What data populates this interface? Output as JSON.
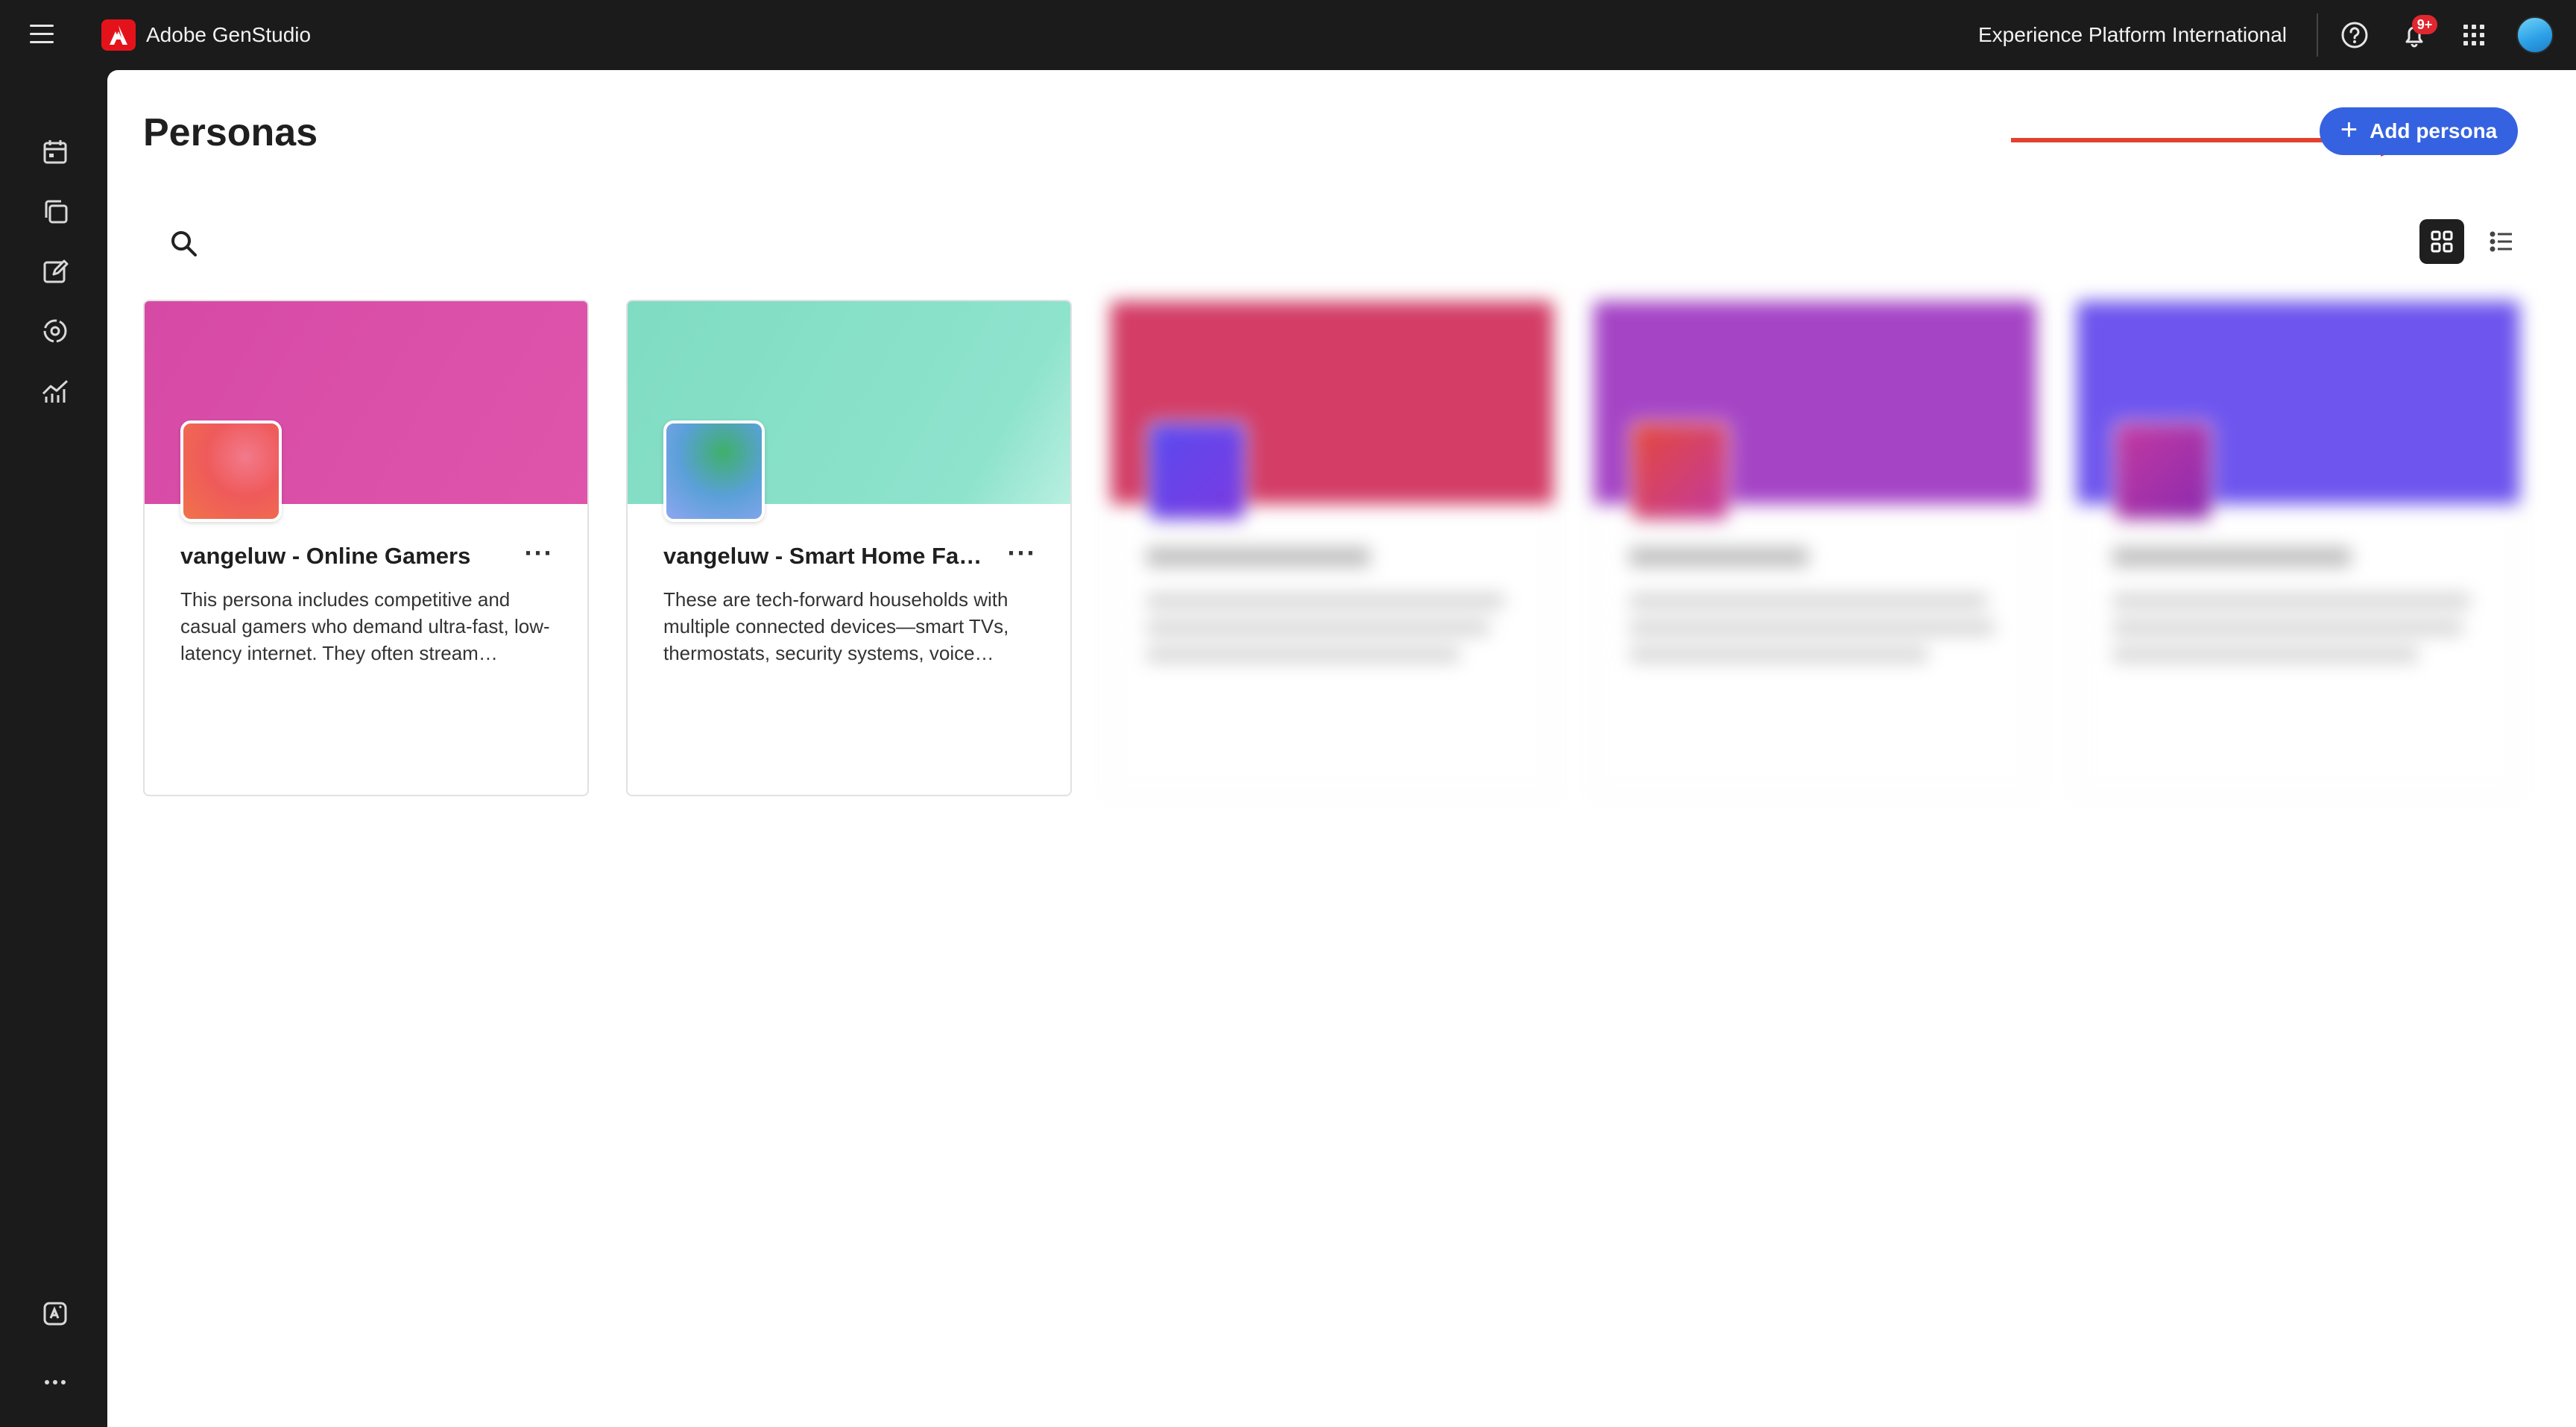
{
  "header": {
    "app_name": "Adobe GenStudio",
    "org_name": "Experience Platform International",
    "notification_badge": "9+"
  },
  "page": {
    "title": "Personas",
    "add_button_label": "Add persona"
  },
  "nav_rail": [
    "calendar-icon",
    "copy-assets-icon",
    "edit-icon",
    "target-icon",
    "insights-chart-icon",
    "brand-shield-icon",
    "more-icon"
  ],
  "cards": [
    {
      "title": "vangeluw - Online Gamers",
      "description": "This persona includes competitive and casual gamers who demand ultra-fast, low-latency internet. They often stream…",
      "banner_color": "#d94aa8",
      "blurred": false
    },
    {
      "title": "vangeluw - Smart Home Fam…",
      "description": "These are tech-forward households with multiple connected devices—smart TVs, thermostats, security systems, voice…",
      "banner_color": "#83ddc4",
      "blurred": false
    },
    {
      "banner_color": "#d33d66",
      "blurred": true
    },
    {
      "banner_color": "#a545c6",
      "blurred": true
    },
    {
      "banner_color": "#6e55ee",
      "blurred": true
    }
  ],
  "colors": {
    "accent": "#3562e0",
    "annotation_arrow": "#e2412f",
    "chrome": "#1b1b1b"
  }
}
